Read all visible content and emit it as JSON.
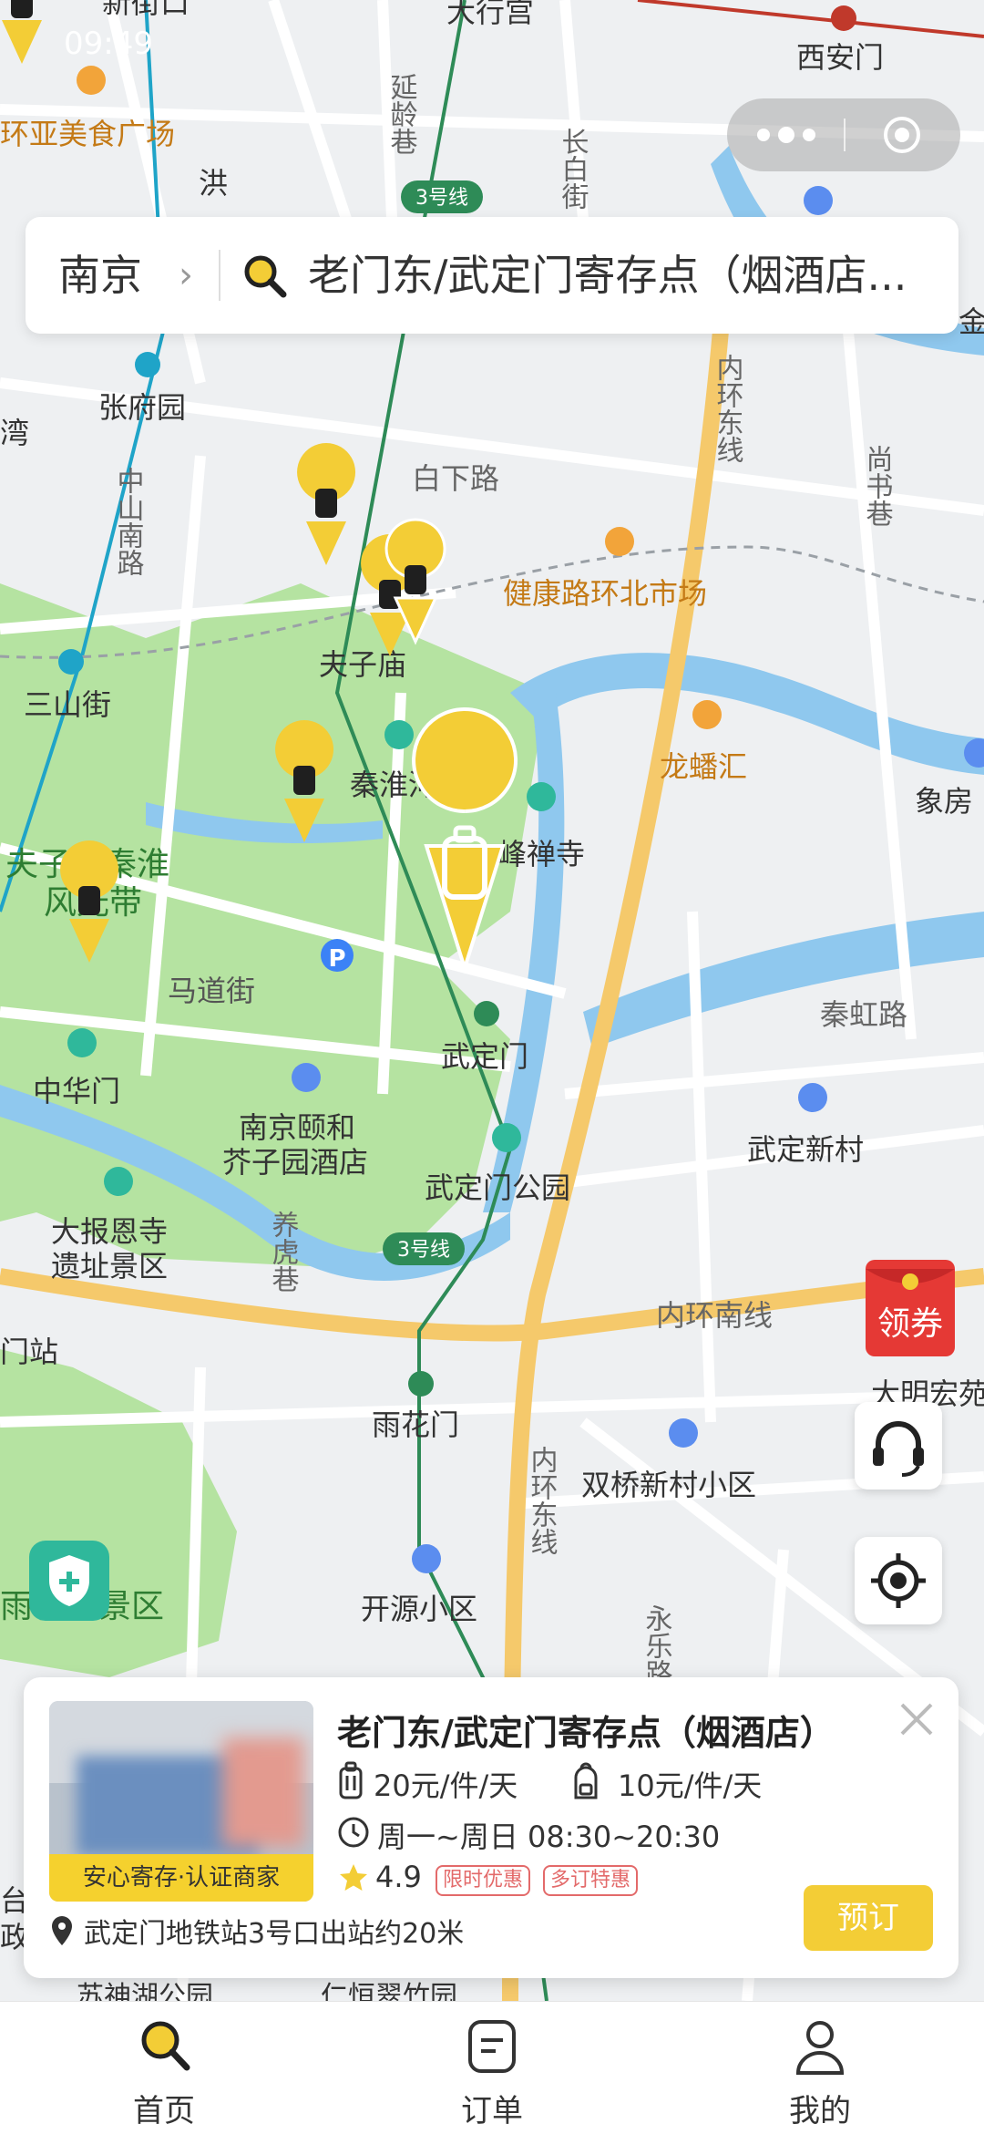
{
  "status_bar": {
    "time": "09:49"
  },
  "search": {
    "city": "南京",
    "query": "老门东/武定门寄存点（烟酒店..."
  },
  "map_labels": {
    "xinjiekou": "新街口",
    "dafugong": "大行宫",
    "xianmen": "西安门",
    "yanlingxiang": "延龄巷",
    "changbaijie": "长白街",
    "huanya": "环亚美食广场",
    "line3_top": "3号线",
    "hong": "洪",
    "zhangfuyuan": "张府园",
    "zhongshannanlu": "中山南路",
    "baixialu": "白下路",
    "neihuandongxian_top": "内环东线",
    "shangshuxiang": "尚书巷",
    "jin": "金",
    "wan": "湾",
    "jiankang": "健康路环北市场",
    "fuzimiao": "夫子庙",
    "sanshanjie": "三山街",
    "qinhuaihe": "秦淮河",
    "longpanhui": "龙蟠汇",
    "xiangfang": "象房",
    "fengchansi": "峰禅寺",
    "fuzimiao_qinhuai": "夫子庙秦淮",
    "fengguangdai": "风光带",
    "madaojie": "马道街",
    "wudingmen": "武定门",
    "qinhonglu": "秦虹路",
    "zhonghuamen": "中华门",
    "yiheliang": "南京颐和",
    "jieziyuan": "芥子园酒店",
    "wudingxincun": "武定新村",
    "wudingmen_park": "武定门公园",
    "dabaoen": "大报恩寺",
    "yizhi": "遗址景区",
    "yanghuxiang": "养虎巷",
    "line3_bottom": "3号线",
    "neihuannanxian": "内环南线",
    "menzhan": "门站",
    "daminghong": "大明宏苑",
    "yuhuamen": "雨花门",
    "neihuandongxian_bottom": "内环东线",
    "shuangqiao": "双桥新村小区",
    "yuhuafengjingqu": "雨花风景区",
    "kaiyuan": "开源小区",
    "yonglelu": "永乐路",
    "taiz": "台",
    "zheng": "政",
    "chenghu": "苏神湖公园",
    "renhe": "仁恒翠竹园"
  },
  "coupon": {
    "label": "领券"
  },
  "detail": {
    "title": "老门东/武定门寄存点（烟酒店）",
    "badge": "安心寄存·认证商家",
    "price_large": "20元/件/天",
    "price_small": "10元/件/天",
    "hours": "周一~周日 08:30~20:30",
    "rating": "4.9",
    "tag1": "限时优惠",
    "tag2": "多订特惠",
    "book_label": "预订",
    "location": "武定门地铁站3号口出站约20米"
  },
  "tabs": [
    {
      "label": "首页",
      "active": true
    },
    {
      "label": "订单",
      "active": false
    },
    {
      "label": "我的",
      "active": false
    }
  ],
  "colors": {
    "accent": "#f3cd36",
    "metro": "#2e8b57",
    "park": "#b5e3a1",
    "water": "#8fc8ee",
    "road_major": "#f5c96b"
  }
}
